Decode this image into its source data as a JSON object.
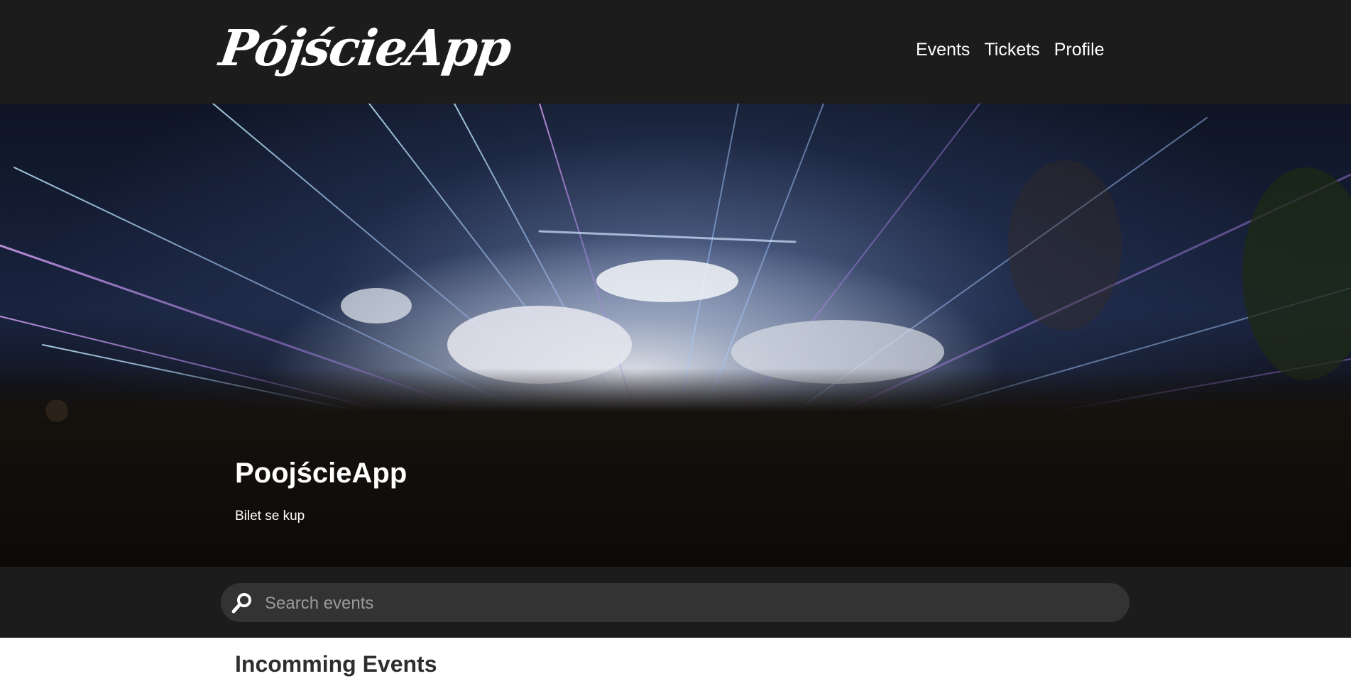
{
  "header": {
    "logo_text": "PójścieApp",
    "nav": [
      {
        "label": "Events"
      },
      {
        "label": "Tickets"
      },
      {
        "label": "Profile"
      }
    ]
  },
  "hero": {
    "title": "PoojścieApp",
    "subtitle": "Bilet se kup",
    "image_icon": "concert-crowd-lasers-image"
  },
  "search": {
    "placeholder": "Search events",
    "value": "",
    "icon": "search-icon"
  },
  "main": {
    "section_title": "Incomming Events"
  },
  "colors": {
    "header_bg": "#1c1c1c",
    "search_bg": "#333333",
    "text_light": "#ffffff",
    "heading_dark": "#2e2e2e"
  }
}
